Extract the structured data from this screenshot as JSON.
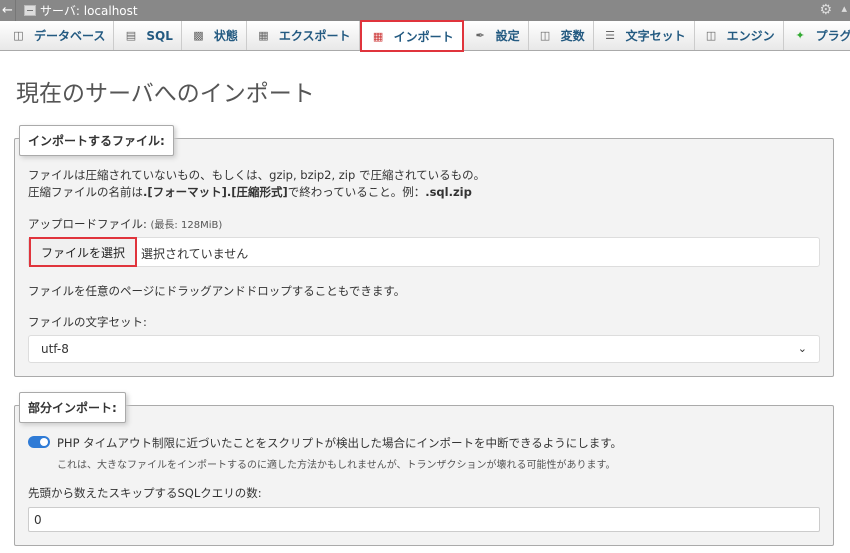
{
  "topbar": {
    "back_icon": "arrow-left-icon",
    "breadcrumb": "サーバ:  localhost",
    "gear_icon": "gear-icon",
    "collapse_icon": "collapse-icon"
  },
  "tabs": [
    {
      "label": "データベース",
      "icon": "database-icon"
    },
    {
      "label": "SQL",
      "icon": "sql-icon"
    },
    {
      "label": "状態",
      "icon": "status-icon"
    },
    {
      "label": "エクスポート",
      "icon": "export-icon"
    },
    {
      "label": "インポート",
      "icon": "import-icon",
      "active": true
    },
    {
      "label": "設定",
      "icon": "wrench-icon"
    },
    {
      "label": "変数",
      "icon": "variables-icon"
    },
    {
      "label": "文字セット",
      "icon": "charset-icon"
    },
    {
      "label": "エンジン",
      "icon": "engine-icon"
    },
    {
      "label": "プラグイン",
      "icon": "plugin-icon"
    }
  ],
  "page": {
    "title": "現在のサーバへのインポート"
  },
  "file_section": {
    "legend": "インポートするファイル:",
    "line1": "ファイルは圧縮されていないもの、もしくは、gzip, bzip2, zip で圧縮されているもの。",
    "line2_prefix": "圧縮ファイルの名前は",
    "line2_format": ".[フォーマット].[圧縮形式]",
    "line2_middle": "で終わっていること。例：",
    "line2_example": ".sql.zip",
    "upload_label": "アップロードファイル:",
    "max_size": "(最長: 128MiB)",
    "choose_button": "ファイルを選択",
    "no_file": "選択されていません",
    "drag_hint": "ファイルを任意のページにドラッグアンドドロップすることもできます。",
    "charset_label": "ファイルの文字セット:",
    "charset_value": "utf-8"
  },
  "partial_section": {
    "legend": "部分インポート:",
    "toggle_label": "PHP タイムアウト制限に近づいたことをスクリプトが検出した場合にインポートを中断できるようにします。",
    "toggle_note": "これは、大きなファイルをインポートするのに適した方法かもしれませんが、トランザクションが壊れる可能性があります。",
    "skip_label": "先頭から数えたスキップするSQLクエリの数:",
    "skip_value": "0"
  }
}
